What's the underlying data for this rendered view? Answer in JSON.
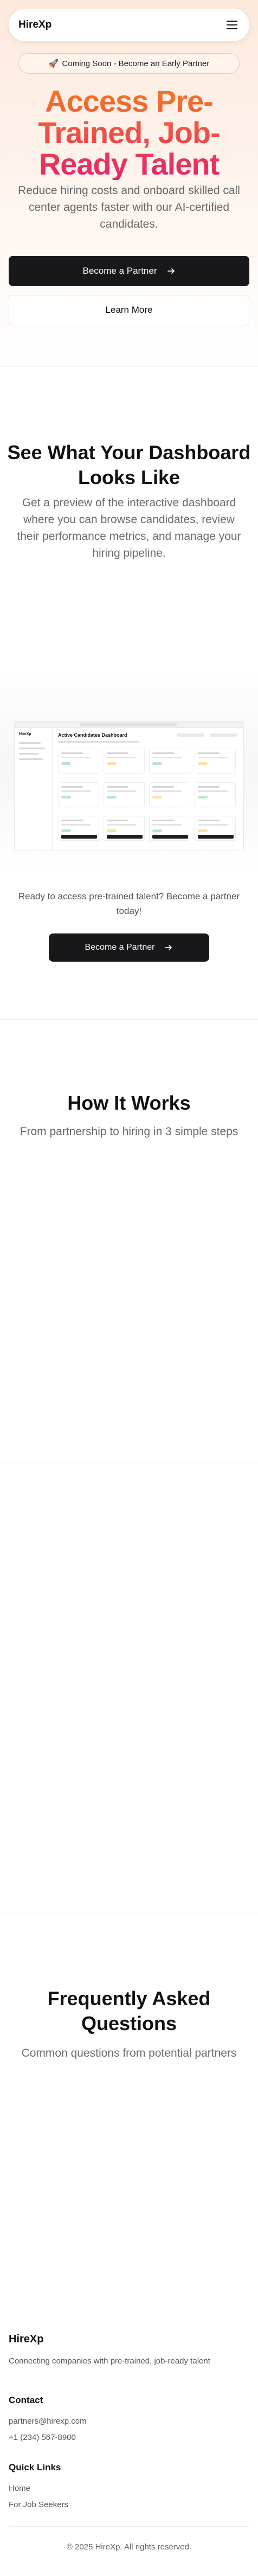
{
  "header": {
    "logo": "HireXp",
    "menu_icon": "hamburger-menu-icon"
  },
  "hero": {
    "badge_icon": "rocket-emoji",
    "badge_emoji": "🚀",
    "badge_text": "Coming Soon - Become an Early Partner",
    "title_line1": "Access Pre-",
    "title_line2": "Trained, Job-",
    "title_line3": "Ready Talent",
    "subtitle": "Reduce hiring costs and onboard skilled call center agents faster with our AI-certified candidates.",
    "primary_button": "Become a Partner",
    "primary_button_icon": "arrow-right-icon",
    "secondary_button": "Learn More",
    "title_gradient": [
      "#f37a1f",
      "#ee4c4a",
      "#e0246f"
    ]
  },
  "dashboard_section": {
    "title": "See What Your Dashboard Looks Like",
    "subtitle": "Get a preview of the interactive dashboard where you can browse candidates, review their performance metrics, and manage your hiring pipeline.",
    "preview": {
      "app_name": "HireXp",
      "heading": "Active Candidates Dashboard"
    },
    "cta_text": "Ready to access pre-trained talent? Become a partner today!",
    "cta_button": "Become a Partner"
  },
  "how_it_works": {
    "title": "How It Works",
    "subtitle": "From partnership to hiring in 3 simple steps"
  },
  "faq": {
    "title": "Frequently Asked Questions",
    "subtitle": "Common questions from potential partners"
  },
  "footer": {
    "logo": "HireXp",
    "description": "Connecting companies with pre-trained, job-ready talent",
    "contact_heading": "Contact",
    "email": "partners@hirexp.com",
    "phone": "+1 (234) 567-8900",
    "quick_links_heading": "Quick Links",
    "links": [
      "Home",
      "For Job Seekers"
    ],
    "copyright": "© 2025 HireXp. All rights reserved."
  },
  "colors": {
    "accent_dark": "#18181b",
    "hero_bg": "#fde9dc",
    "badge_border": "#f3c9a8"
  }
}
